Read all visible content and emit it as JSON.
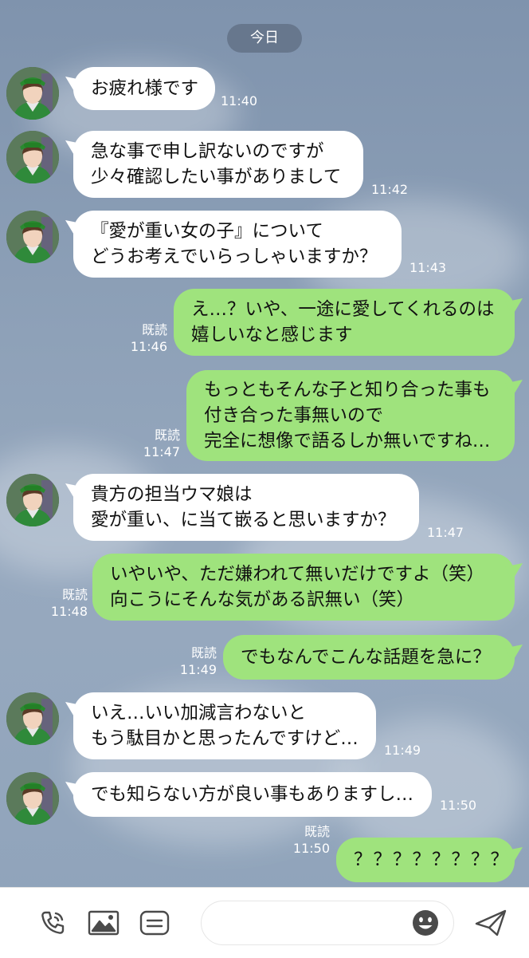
{
  "date_label": "今日",
  "read_label": "既読",
  "messages": [
    {
      "side": "in",
      "lines": "お疲れ様です",
      "time": "11:40"
    },
    {
      "side": "in",
      "lines": "急な事で申し訳ないのですが\n少々確認したい事がありまして",
      "time": "11:42"
    },
    {
      "side": "in",
      "lines": "『愛が重い女の子』について\nどうお考えでいらっしゃいますか？",
      "time": "11:43"
    },
    {
      "side": "out",
      "lines": "え…？いや、一途に愛してくれるのは\n嬉しいなと感じます",
      "time": "11:46"
    },
    {
      "side": "out",
      "lines": "もっともそんな子と知り合った事も\n付き合った事無いので\n完全に想像で語るしか無いですね…",
      "time": "11:47"
    },
    {
      "side": "in",
      "lines": "貴方の担当ウマ娘は\n愛が重い、に当て嵌ると思いますか？",
      "time": "11:47"
    },
    {
      "side": "out",
      "lines": "いやいや、ただ嫌われて無いだけですよ（笑）\n向こうにそんな気がある訳無い（笑）",
      "time": "11:48"
    },
    {
      "side": "out",
      "lines": "でもなんでこんな話題を急に？",
      "time": "11:49"
    },
    {
      "side": "in",
      "lines": "いえ…いい加減言わないと\nもう駄目かと思ったんですけど…",
      "time": "11:49"
    },
    {
      "side": "in",
      "lines": "でも知らない方が良い事もありますし…",
      "time": "11:50"
    },
    {
      "side": "out",
      "lines": "？？？？？？？？",
      "time": "11:50"
    }
  ],
  "input": {
    "placeholder": ""
  },
  "icons": [
    "phone-icon",
    "image-icon",
    "sticker-list-icon",
    "emoji-icon",
    "send-icon"
  ]
}
